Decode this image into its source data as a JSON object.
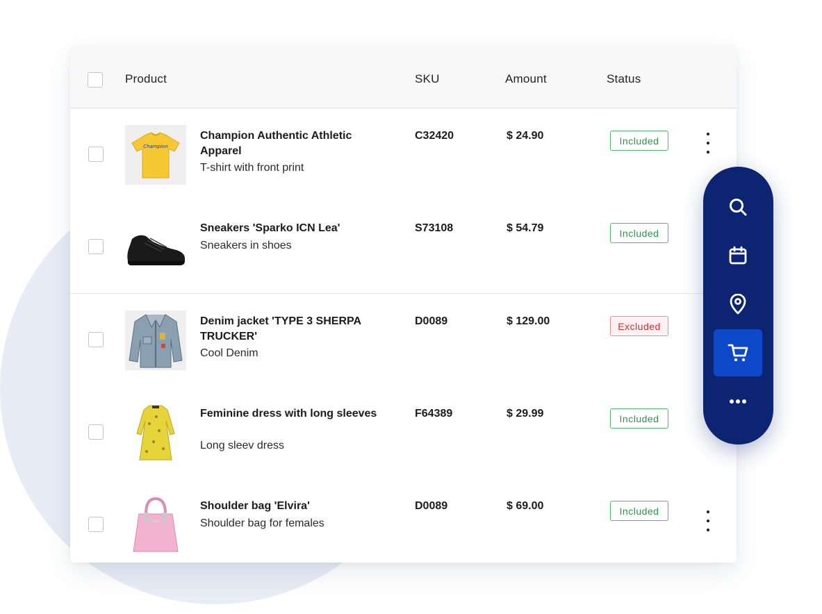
{
  "table": {
    "columns": {
      "product": "Product",
      "sku": "SKU",
      "amount": "Amount",
      "status": "Status"
    },
    "rows": [
      {
        "name": "Champion Authentic Athletic Apparel",
        "description": "T-shirt with front print",
        "sku": "C32420",
        "amount": "$ 24.90",
        "status": "Included",
        "thumbnail_icon": "yellow-tshirt-image",
        "thumbnail_brand": "Champion"
      },
      {
        "name": "Sneakers 'Sparko ICN Lea'",
        "description": "Sneakers in shoes",
        "sku": "S73108",
        "amount": "$ 54.79",
        "status": "Included",
        "thumbnail_icon": "black-sneaker-image"
      },
      {
        "name": "Denim jacket 'TYPE 3 SHERPA TRUCKER'",
        "description": "Cool Denim",
        "sku": "D0089",
        "amount": "$ 129.00",
        "status": "Excluded",
        "thumbnail_icon": "denim-jacket-image"
      },
      {
        "name": "Feminine dress with long sleeves",
        "description": "Long sleev dress",
        "sku": "F64389",
        "amount": "$ 29.99",
        "status": "Included",
        "thumbnail_icon": "yellow-dress-image"
      },
      {
        "name": "Shoulder bag 'Elvira'",
        "description": "Shoulder bag for females",
        "sku": "D0089",
        "amount": "$ 69.00",
        "status": "Included",
        "thumbnail_icon": "pink-handbag-image"
      }
    ]
  },
  "floating_toolbar": {
    "buttons": [
      {
        "icon": "search-icon",
        "active": false
      },
      {
        "icon": "calendar-icon",
        "active": false
      },
      {
        "icon": "location-pin-icon",
        "active": false
      },
      {
        "icon": "cart-icon",
        "active": true
      },
      {
        "icon": "more-horizontal-icon",
        "active": false
      }
    ]
  },
  "colors": {
    "toolbar_bg": "#0c2471",
    "toolbar_active": "#0c48c8",
    "included": "#239a45",
    "excluded": "#d62b2b",
    "background_circle": "#e7ecf6"
  }
}
